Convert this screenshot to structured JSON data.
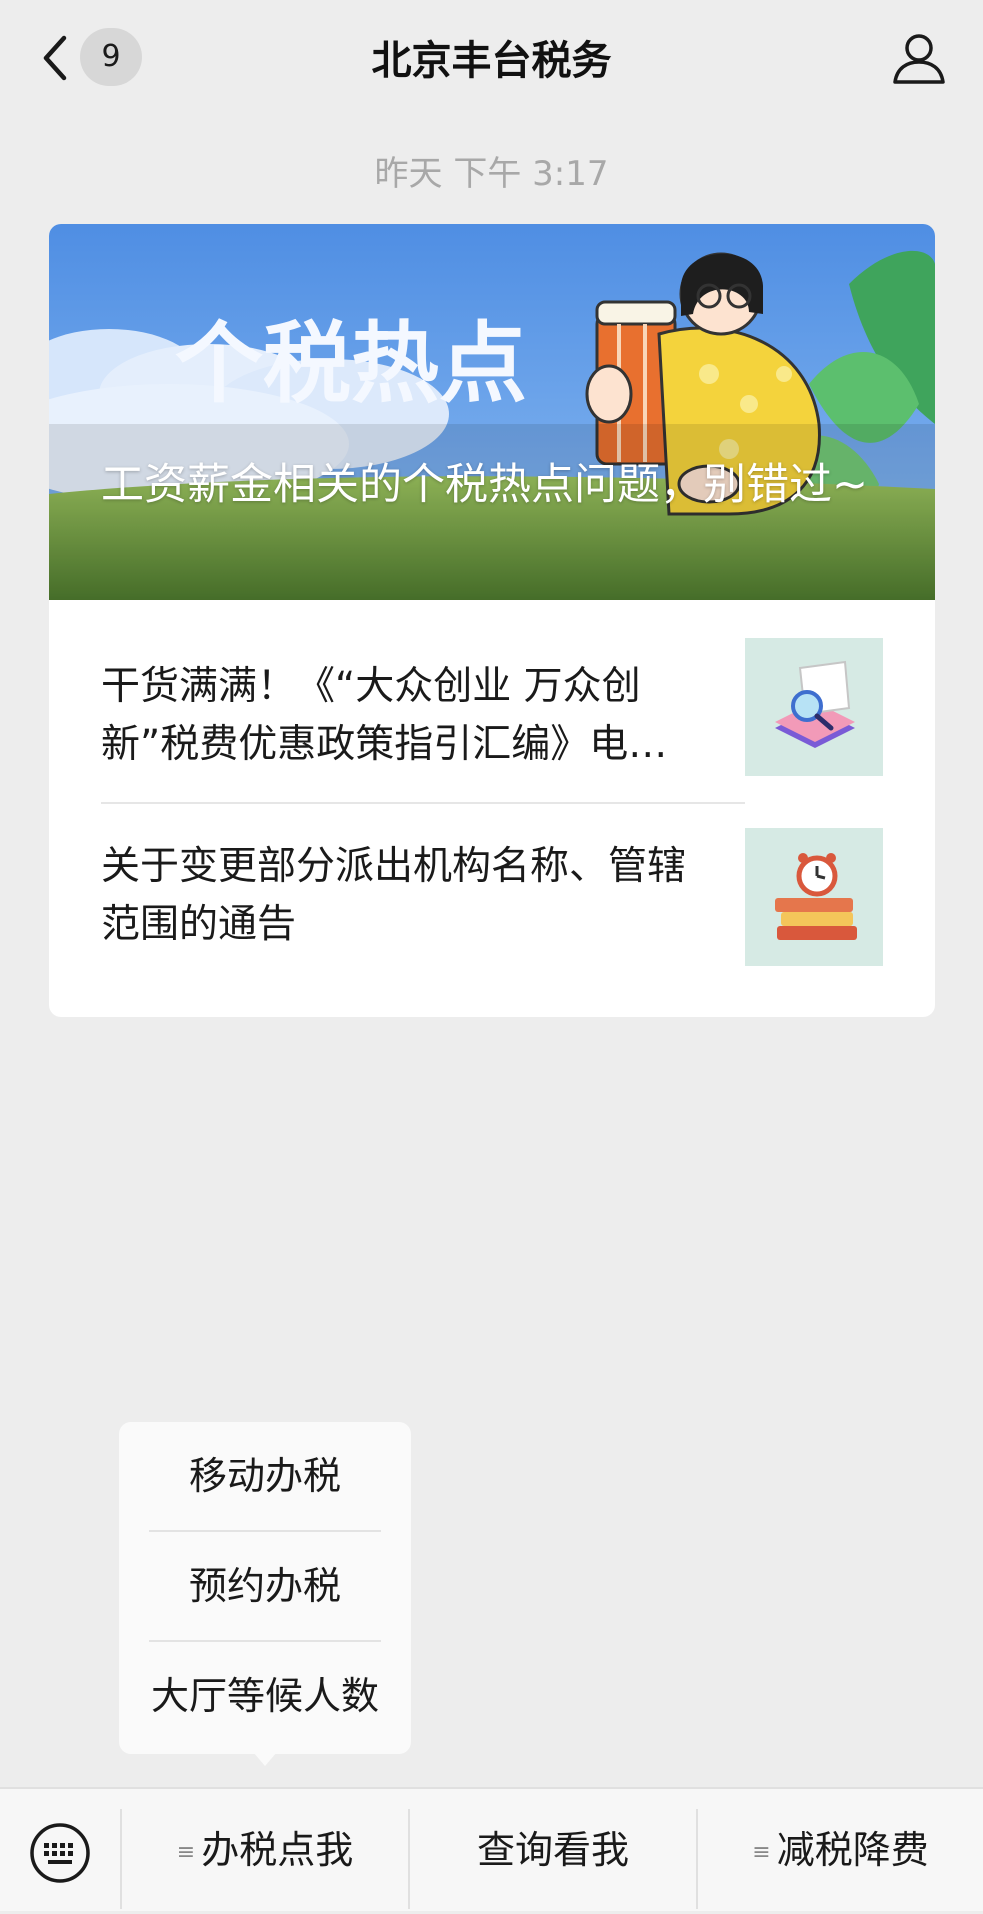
{
  "header": {
    "unread_count": "9",
    "title": "北京丰台税务"
  },
  "timestamp": "昨天 下午 3:17",
  "article": {
    "cover_title": "工资薪金相关的个税热点问题，别错过~",
    "cover_banner_text": "个税热点",
    "items": [
      {
        "title": "干货满满！《“大众创业 万众创新”税费优惠政策指引汇编》电…"
      },
      {
        "title": "关于变更部分派出机构名称、管辖范围的通告"
      }
    ]
  },
  "popup_menu": {
    "items": [
      "移动办税",
      "预约办税",
      "大厅等候人数"
    ]
  },
  "bottom_bar": {
    "tabs": [
      {
        "label": "办税点我",
        "has_submenu": true
      },
      {
        "label": "查询看我",
        "has_submenu": false
      },
      {
        "label": "减税降费",
        "has_submenu": true
      }
    ]
  },
  "icons": {
    "back": "chevron-left-icon",
    "profile": "person-icon",
    "keyboard": "keyboard-icon",
    "menu": "menu-lines-icon"
  },
  "colors": {
    "background": "#ededed",
    "card": "#ffffff",
    "cover_sky": "#5b97e6",
    "cover_grass": "#7aa84c"
  }
}
